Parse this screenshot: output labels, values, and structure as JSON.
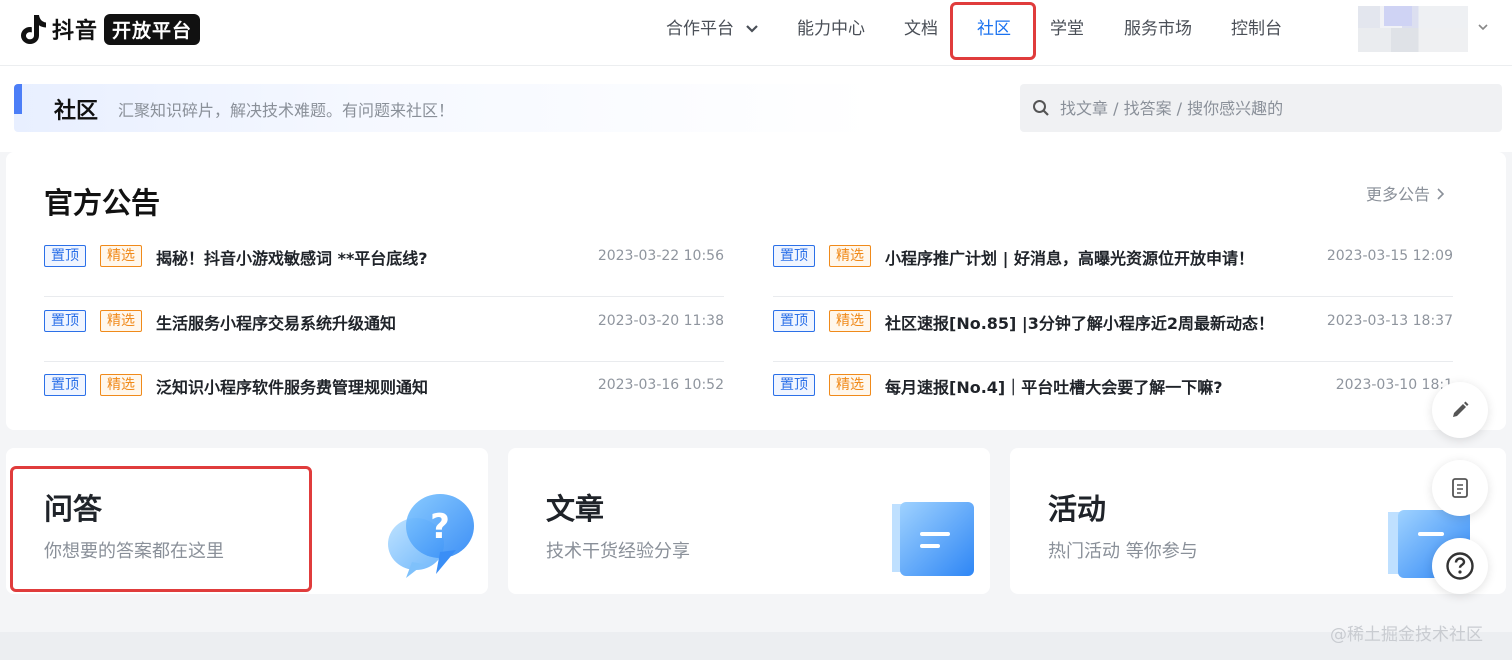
{
  "brand": {
    "name": "抖音",
    "badge": "开放平台"
  },
  "nav": {
    "items": [
      {
        "label": "合作平台",
        "has_dropdown": true
      },
      {
        "label": "能力中心"
      },
      {
        "label": "文档"
      },
      {
        "label": "社区",
        "active": true
      },
      {
        "label": "学堂"
      },
      {
        "label": "服务市场"
      },
      {
        "label": "控制台"
      }
    ]
  },
  "community": {
    "title": "社区",
    "subtitle": "汇聚知识碎片，解决技术难题。有问题来社区！",
    "search_placeholder": "找文章 / 找答案 / 搜你感兴趣的"
  },
  "announcements": {
    "title": "官方公告",
    "more_label": "更多公告",
    "tag_top": "置顶",
    "tag_pick": "精选",
    "left": [
      {
        "title": "揭秘！抖音小游戏敏感词 **平台底线?",
        "date": "2023-03-22 10:56"
      },
      {
        "title": "生活服务小程序交易系统升级通知",
        "date": "2023-03-20 11:38"
      },
      {
        "title": "泛知识小程序软件服务费管理规则通知",
        "date": "2023-03-16 10:52"
      }
    ],
    "right": [
      {
        "title": "小程序推广计划 | 好消息，高曝光资源位开放申请！",
        "date": "2023-03-15 12:09"
      },
      {
        "title": "社区速报[No.85] |3分钟了解小程序近2周最新动态！",
        "date": "2023-03-13 18:37"
      },
      {
        "title": "每月速报[No.4]｜平台吐槽大会要了解一下嘛?",
        "date": "2023-03-10 18:1"
      }
    ]
  },
  "cards": [
    {
      "title": "问答",
      "desc": "你想要的答案都在这里",
      "icon": "qa-bubble-icon"
    },
    {
      "title": "文章",
      "desc": "技术干货经验分享",
      "icon": "article-folder-icon"
    },
    {
      "title": "活动",
      "desc": "热门活动 等你参与",
      "icon": "activity-folder-icon"
    }
  ],
  "watermark": "@稀土掘金技术社区",
  "colors": {
    "accent": "#1a72f0",
    "highlight_box": "#e03c3c",
    "tag_top": "#2b70e8",
    "tag_pick": "#f08a1a"
  }
}
